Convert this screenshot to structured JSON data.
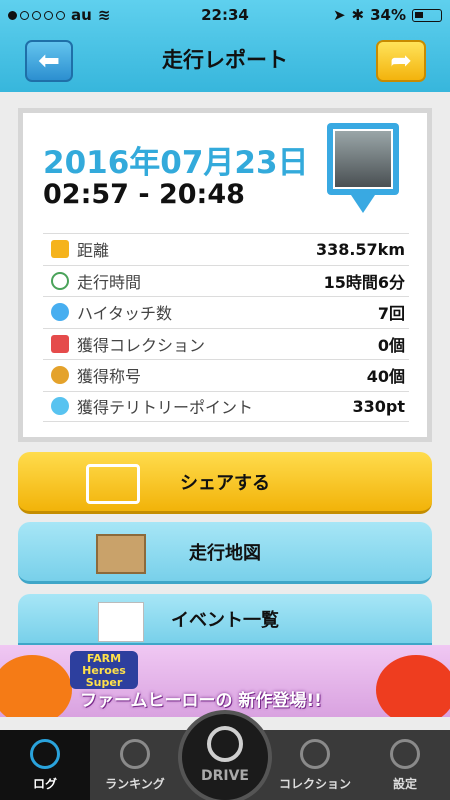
{
  "status": {
    "carrier": "au",
    "time": "22:34",
    "battery": "34%"
  },
  "nav": {
    "title": "走行レポート"
  },
  "report": {
    "date": "2016年07月23日",
    "time_range": "02:57 - 20:48",
    "rows": [
      {
        "icon": "km-icon",
        "label": "距離",
        "value": "338.57km"
      },
      {
        "icon": "clock-icon",
        "label": "走行時間",
        "value": "15時間6分"
      },
      {
        "icon": "hand-icon",
        "label": "ハイタッチ数",
        "value": "7回"
      },
      {
        "icon": "car-icon",
        "label": "獲得コレクション",
        "value": "0個"
      },
      {
        "icon": "medal-icon",
        "label": "獲得称号",
        "value": "40個"
      },
      {
        "icon": "spot-icon",
        "label": "獲得テリトリーポイント",
        "value": "330pt"
      }
    ]
  },
  "actions": {
    "share": "シェアする",
    "map": "走行地図",
    "events": "イベント一覧"
  },
  "ad": {
    "logo": "FARM Heroes Super",
    "slogan": "ファームヒーローの 新作登場!!"
  },
  "tabs": {
    "log": "ログ",
    "ranking": "ランキング",
    "drive": "DRIVE",
    "collection": "コレクション",
    "settings": "設定"
  },
  "colors": {
    "accent_blue": "#33aadb",
    "share_yellow": "#f2b309",
    "nav_blue": "#37b6dc"
  }
}
